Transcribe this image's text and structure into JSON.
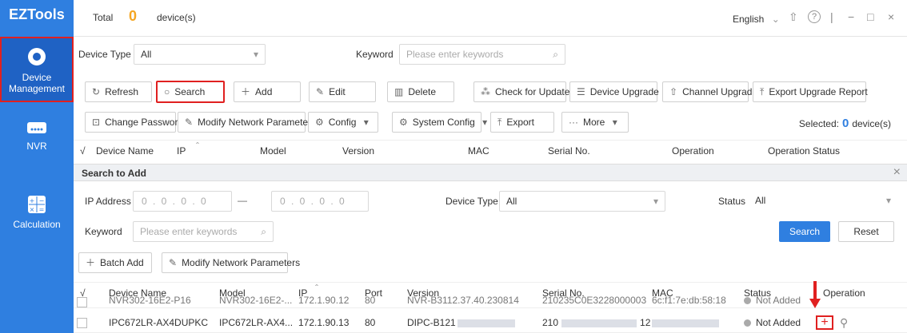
{
  "app": {
    "name": "EZTools"
  },
  "sidebar": {
    "items": [
      {
        "label_line1": "Device",
        "label_line2": "Management",
        "active": true
      },
      {
        "label": "NVR"
      },
      {
        "label": "Calculation"
      }
    ]
  },
  "topbar": {
    "total_label": "Total",
    "total_count": "0",
    "device_unit": "device(s)",
    "language": "English"
  },
  "filters": {
    "device_type_label": "Device Type",
    "device_type_value": "All",
    "keyword_label": "Keyword",
    "keyword_placeholder": "Please enter keywords"
  },
  "toolbar1": {
    "refresh": "Refresh",
    "search": "Search",
    "add": "Add",
    "edit": "Edit",
    "delete": "Delete",
    "check_updates": "Check for Updates",
    "device_upgrade": "Device Upgrade",
    "channel_upgrade": "Channel Upgrade",
    "export_report": "Export Upgrade Report"
  },
  "toolbar2": {
    "change_password": "Change Password",
    "modify_network": "Modify Network Parameters",
    "config": "Config",
    "system_config": "System Config",
    "export": "Export",
    "more": "More",
    "selected_label": "Selected:",
    "selected_count": "0",
    "selected_unit": "device(s)"
  },
  "main_table": {
    "check_header": "√",
    "headers": [
      "Device Name",
      "IP",
      "Model",
      "Version",
      "MAC",
      "Serial No.",
      "Operation",
      "Operation Status"
    ]
  },
  "search_panel": {
    "title": "Search to Add",
    "ip_label": "IP Address",
    "ip_start": "0 . 0 . 0 . 0",
    "ip_sep": "—",
    "ip_end": "0 . 0 . 0 . 0",
    "device_type_label": "Device Type",
    "device_type_value": "All",
    "status_label": "Status",
    "status_value": "All",
    "keyword_label": "Keyword",
    "keyword_placeholder": "Please enter keywords",
    "search_btn": "Search",
    "reset_btn": "Reset",
    "batch_add": "Batch Add",
    "modify_network": "Modify Network Parameters",
    "headers": [
      "√",
      "Device Name",
      "Model",
      "IP",
      "Port",
      "Version",
      "Serial No.",
      "MAC",
      "Status",
      "Operation"
    ],
    "rows": [
      {
        "name": "NVR302-16E2-P16",
        "model": "NVR302-16E2-...",
        "ip": "172.1.90.12",
        "port": "80",
        "version": "NVR-B3112.37.40.230814",
        "serial": "210235C0E3228000003",
        "mac": "6c:f1:7e:db:58:18",
        "status": "Not Added"
      },
      {
        "name": "IPC672LR-AX4DUPKC",
        "model": "IPC672LR-AX4...",
        "ip": "172.1.90.13",
        "port": "80",
        "version": "DIPC-B121",
        "serial_prefix": "210",
        "serial_suffix": "12",
        "status": "Not Added"
      }
    ]
  }
}
